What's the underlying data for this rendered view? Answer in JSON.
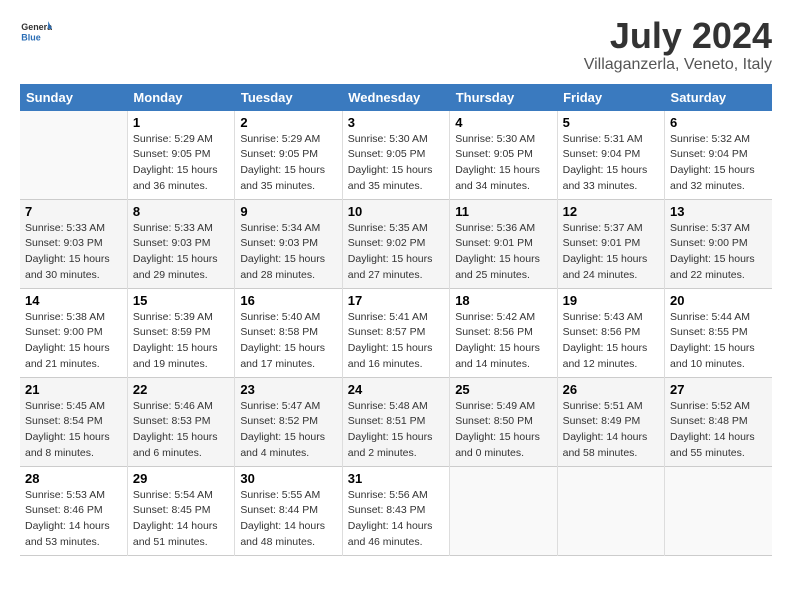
{
  "header": {
    "logo_general": "General",
    "logo_blue": "Blue",
    "title": "July 2024",
    "subtitle": "Villaganzerla, Veneto, Italy"
  },
  "calendar": {
    "headers": [
      "Sunday",
      "Monday",
      "Tuesday",
      "Wednesday",
      "Thursday",
      "Friday",
      "Saturday"
    ],
    "rows": [
      [
        {
          "day": "",
          "info": ""
        },
        {
          "day": "1",
          "info": "Sunrise: 5:29 AM\nSunset: 9:05 PM\nDaylight: 15 hours\nand 36 minutes."
        },
        {
          "day": "2",
          "info": "Sunrise: 5:29 AM\nSunset: 9:05 PM\nDaylight: 15 hours\nand 35 minutes."
        },
        {
          "day": "3",
          "info": "Sunrise: 5:30 AM\nSunset: 9:05 PM\nDaylight: 15 hours\nand 35 minutes."
        },
        {
          "day": "4",
          "info": "Sunrise: 5:30 AM\nSunset: 9:05 PM\nDaylight: 15 hours\nand 34 minutes."
        },
        {
          "day": "5",
          "info": "Sunrise: 5:31 AM\nSunset: 9:04 PM\nDaylight: 15 hours\nand 33 minutes."
        },
        {
          "day": "6",
          "info": "Sunrise: 5:32 AM\nSunset: 9:04 PM\nDaylight: 15 hours\nand 32 minutes."
        }
      ],
      [
        {
          "day": "7",
          "info": "Sunrise: 5:33 AM\nSunset: 9:03 PM\nDaylight: 15 hours\nand 30 minutes."
        },
        {
          "day": "8",
          "info": "Sunrise: 5:33 AM\nSunset: 9:03 PM\nDaylight: 15 hours\nand 29 minutes."
        },
        {
          "day": "9",
          "info": "Sunrise: 5:34 AM\nSunset: 9:03 PM\nDaylight: 15 hours\nand 28 minutes."
        },
        {
          "day": "10",
          "info": "Sunrise: 5:35 AM\nSunset: 9:02 PM\nDaylight: 15 hours\nand 27 minutes."
        },
        {
          "day": "11",
          "info": "Sunrise: 5:36 AM\nSunset: 9:01 PM\nDaylight: 15 hours\nand 25 minutes."
        },
        {
          "day": "12",
          "info": "Sunrise: 5:37 AM\nSunset: 9:01 PM\nDaylight: 15 hours\nand 24 minutes."
        },
        {
          "day": "13",
          "info": "Sunrise: 5:37 AM\nSunset: 9:00 PM\nDaylight: 15 hours\nand 22 minutes."
        }
      ],
      [
        {
          "day": "14",
          "info": "Sunrise: 5:38 AM\nSunset: 9:00 PM\nDaylight: 15 hours\nand 21 minutes."
        },
        {
          "day": "15",
          "info": "Sunrise: 5:39 AM\nSunset: 8:59 PM\nDaylight: 15 hours\nand 19 minutes."
        },
        {
          "day": "16",
          "info": "Sunrise: 5:40 AM\nSunset: 8:58 PM\nDaylight: 15 hours\nand 17 minutes."
        },
        {
          "day": "17",
          "info": "Sunrise: 5:41 AM\nSunset: 8:57 PM\nDaylight: 15 hours\nand 16 minutes."
        },
        {
          "day": "18",
          "info": "Sunrise: 5:42 AM\nSunset: 8:56 PM\nDaylight: 15 hours\nand 14 minutes."
        },
        {
          "day": "19",
          "info": "Sunrise: 5:43 AM\nSunset: 8:56 PM\nDaylight: 15 hours\nand 12 minutes."
        },
        {
          "day": "20",
          "info": "Sunrise: 5:44 AM\nSunset: 8:55 PM\nDaylight: 15 hours\nand 10 minutes."
        }
      ],
      [
        {
          "day": "21",
          "info": "Sunrise: 5:45 AM\nSunset: 8:54 PM\nDaylight: 15 hours\nand 8 minutes."
        },
        {
          "day": "22",
          "info": "Sunrise: 5:46 AM\nSunset: 8:53 PM\nDaylight: 15 hours\nand 6 minutes."
        },
        {
          "day": "23",
          "info": "Sunrise: 5:47 AM\nSunset: 8:52 PM\nDaylight: 15 hours\nand 4 minutes."
        },
        {
          "day": "24",
          "info": "Sunrise: 5:48 AM\nSunset: 8:51 PM\nDaylight: 15 hours\nand 2 minutes."
        },
        {
          "day": "25",
          "info": "Sunrise: 5:49 AM\nSunset: 8:50 PM\nDaylight: 15 hours\nand 0 minutes."
        },
        {
          "day": "26",
          "info": "Sunrise: 5:51 AM\nSunset: 8:49 PM\nDaylight: 14 hours\nand 58 minutes."
        },
        {
          "day": "27",
          "info": "Sunrise: 5:52 AM\nSunset: 8:48 PM\nDaylight: 14 hours\nand 55 minutes."
        }
      ],
      [
        {
          "day": "28",
          "info": "Sunrise: 5:53 AM\nSunset: 8:46 PM\nDaylight: 14 hours\nand 53 minutes."
        },
        {
          "day": "29",
          "info": "Sunrise: 5:54 AM\nSunset: 8:45 PM\nDaylight: 14 hours\nand 51 minutes."
        },
        {
          "day": "30",
          "info": "Sunrise: 5:55 AM\nSunset: 8:44 PM\nDaylight: 14 hours\nand 48 minutes."
        },
        {
          "day": "31",
          "info": "Sunrise: 5:56 AM\nSunset: 8:43 PM\nDaylight: 14 hours\nand 46 minutes."
        },
        {
          "day": "",
          "info": ""
        },
        {
          "day": "",
          "info": ""
        },
        {
          "day": "",
          "info": ""
        }
      ]
    ]
  }
}
